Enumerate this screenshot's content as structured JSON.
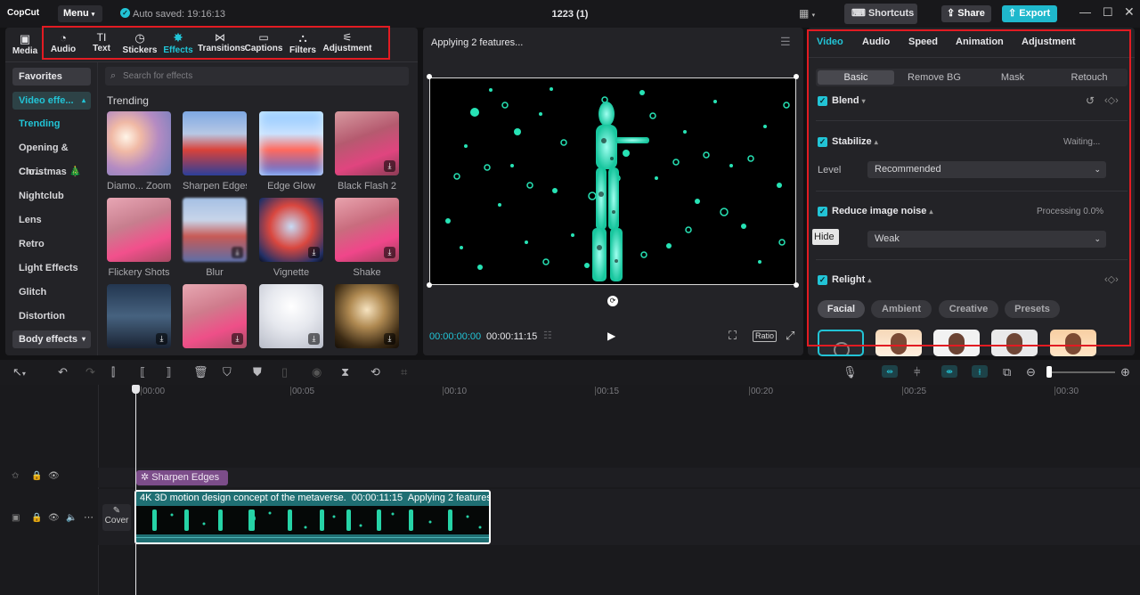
{
  "app": {
    "logo": "CopCut",
    "menu": "Menu",
    "autosave": "Auto saved: 19:16:13",
    "project": "1223 (1)",
    "shortcuts": "Shortcuts",
    "share": "Share",
    "export": "Export"
  },
  "toolbar": [
    {
      "label": "Media",
      "icon": "media-icon"
    },
    {
      "label": "Audio",
      "icon": "audio-icon"
    },
    {
      "label": "Text",
      "icon": "text-icon"
    },
    {
      "label": "Stickers",
      "icon": "stickers-icon"
    },
    {
      "label": "Effects",
      "icon": "effects-icon"
    },
    {
      "label": "Transitions",
      "icon": "transitions-icon"
    },
    {
      "label": "Captions",
      "icon": "captions-icon"
    },
    {
      "label": "Filters",
      "icon": "filters-icon"
    },
    {
      "label": "Adjustment",
      "icon": "adjustment-icon"
    }
  ],
  "leftnav": {
    "favorites": "Favorites",
    "video_effects": "Video effe...",
    "items": [
      "Trending",
      "Opening & Clo...",
      "Christmas 🎄",
      "Nightclub",
      "Lens",
      "Retro",
      "Light Effects",
      "Glitch",
      "Distortion"
    ],
    "body_effects": "Body effects"
  },
  "effects": {
    "search_placeholder": "Search for effects",
    "section": "Trending",
    "items": [
      "Diamo... Zoom",
      "Sharpen Edges",
      "Edge Glow",
      "Black Flash 2",
      "Flickery Shots",
      "Blur",
      "Vignette",
      "Shake"
    ]
  },
  "player": {
    "title": "Applying 2 features...",
    "current_time": "00:00:00:00",
    "total_time": "00:00:11:15",
    "ratio": "Ratio"
  },
  "inspector": {
    "tabs": [
      "Video",
      "Audio",
      "Speed",
      "Animation",
      "Adjustment"
    ],
    "subtabs": [
      "Basic",
      "Remove BG",
      "Mask",
      "Retouch"
    ],
    "blend": "Blend",
    "stabilize": "Stabilize",
    "stabilize_status": "Waiting...",
    "level_label": "Level",
    "level_value": "Recommended",
    "reduce_noise": "Reduce image noise",
    "noise_status": "Processing 0.0%",
    "noise_tooltip": "Hide",
    "noise_value": "Weak",
    "relight": "Relight",
    "relight_tabs": [
      "Facial",
      "Ambient",
      "Creative",
      "Presets"
    ]
  },
  "timeline": {
    "ruler": [
      "00:00",
      "00:05",
      "00:10",
      "00:15",
      "00:20",
      "00:25",
      "00:30"
    ],
    "effect_clip": "Sharpen Edges",
    "video_clip_name": "4K 3D motion design concept of the metaverse.",
    "video_clip_duration": "00:00:11:15",
    "video_clip_status": "Applying 2 features...",
    "cover": "Cover"
  },
  "colors": {
    "accent": "#22c4d6",
    "highlight": "#e21b22",
    "effect_clip": "#7c4d8a",
    "video_clip": "#1f6f73"
  }
}
